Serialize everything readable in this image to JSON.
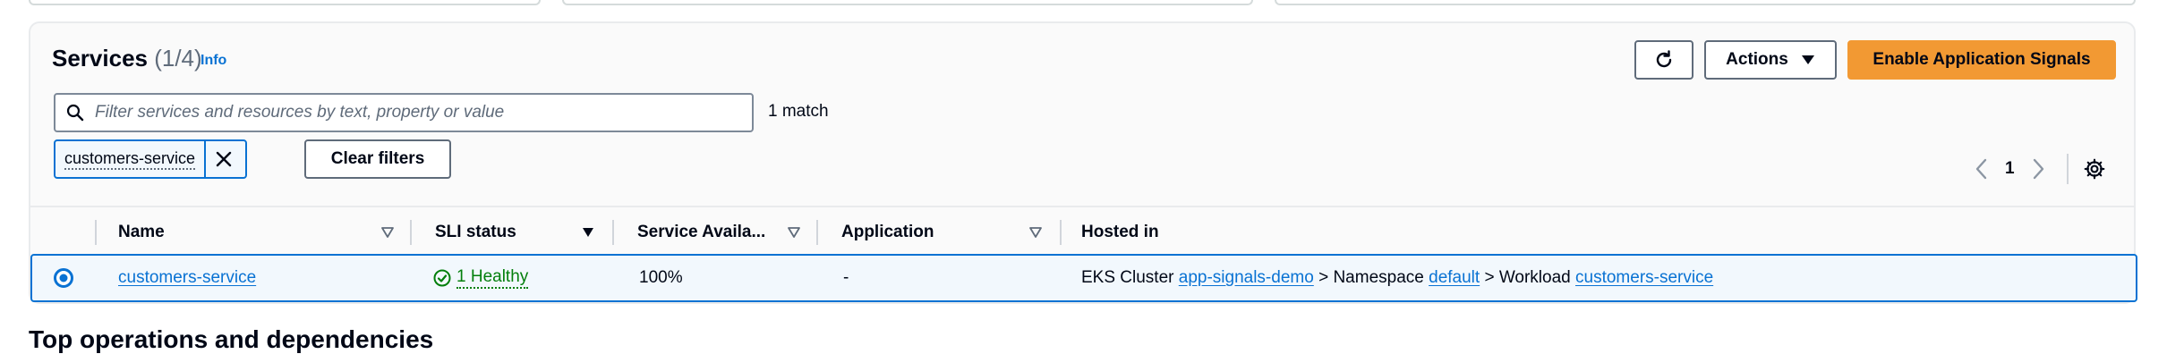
{
  "services": {
    "title": "Services",
    "count": "(1/4)",
    "info_link": "Info",
    "refresh_icon": "refresh-icon",
    "actions_label": "Actions",
    "enable_label": "Enable Application Signals",
    "search": {
      "placeholder": "Filter services and resources by text, property or value",
      "match_count": "1 match"
    },
    "filter_token": "customers-service",
    "clear_filters_label": "Clear filters",
    "pagination": {
      "current_page": "1"
    },
    "columns": [
      "Name",
      "SLI status",
      "Service Availa...",
      "Application",
      "Hosted in"
    ],
    "rows": [
      {
        "name": "customers-service",
        "sli_status": "1 Healthy",
        "availability": "100%",
        "application": "-",
        "hosted": {
          "prefix": "EKS Cluster",
          "cluster": "app-signals-demo",
          "namespace_label": "> Namespace",
          "namespace": "default",
          "workload_label": "> Workload",
          "workload": "customers-service"
        }
      }
    ]
  },
  "colors": {
    "primary": "#f29933",
    "link": "#0972d3",
    "success": "#037f0c"
  },
  "next_section_title": "Top operations and dependencies"
}
